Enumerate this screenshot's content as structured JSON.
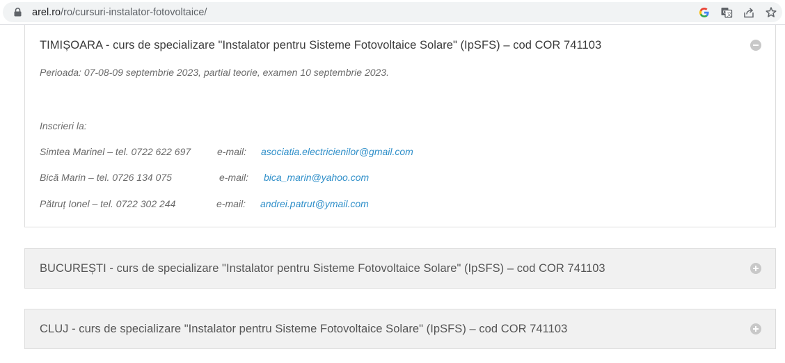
{
  "browser": {
    "url_domain": "arel.ro",
    "url_path": "/ro/cursuri-instalator-fotovoltaice/",
    "icons": [
      "lock-icon",
      "google-icon",
      "translate-icon",
      "share-icon",
      "bookmark-star-icon"
    ]
  },
  "accordion": {
    "open_panel": {
      "title": "TIMIȘOARA - curs de specializare \"Instalator pentru Sisteme Fotovoltaice Solare\" (IpSFS) – cod COR 741103",
      "period": "Perioada: 07-08-09 septembrie 2023, partial teorie, examen 10 septembrie 2023.",
      "enroll_label": "Inscrieri la:",
      "contacts": [
        {
          "person": "Simtea Marinel – tel. 0722 622 697",
          "email_label": "e-mail:",
          "email": "asociatia.electricienilor@gmail.com"
        },
        {
          "person": "Bică Marin – tel. 0726 134 075",
          "email_label": "e-mail:",
          "email": "bica_marin@yahoo.com"
        },
        {
          "person": "Pătruț Ionel – tel. 0722 302 244",
          "email_label": "e-mail:",
          "email": "andrei.patrut@ymail.com"
        }
      ],
      "toggle_icon": "minus-circle-icon"
    },
    "closed_panels": [
      {
        "title": "BUCUREȘTI - curs de specializare \"Instalator pentru Sisteme Fotovoltaice Solare\" (IpSFS) – cod COR 741103",
        "toggle_icon": "plus-circle-icon"
      },
      {
        "title": "CLUJ - curs de specializare \"Instalator pentru Sisteme Fotovoltaice Solare\" (IpSFS) – cod COR 741103",
        "toggle_icon": "plus-circle-icon"
      }
    ]
  },
  "colors": {
    "link": "#2f8fc9",
    "closed_panel_bg": "#f1f1f1",
    "border": "#dddddd"
  }
}
